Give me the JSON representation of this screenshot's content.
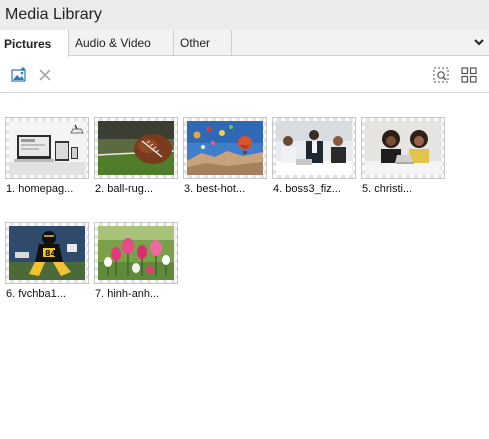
{
  "window": {
    "title": "Media Library"
  },
  "tabs": [
    {
      "label": "Pictures",
      "active": true
    },
    {
      "label": "Audio & Video",
      "active": false
    },
    {
      "label": "Other",
      "active": false
    }
  ],
  "toolbar": {
    "icons": [
      "insert-picture-icon",
      "delete-icon",
      "select-area-icon",
      "grid-view-icon"
    ]
  },
  "colors": {
    "accent": "#2b79c2",
    "tab_bar": "#f2f2f2",
    "title_bar": "#ececec"
  },
  "items": [
    {
      "caption": "1. homepag..."
    },
    {
      "caption": "2. ball-rug..."
    },
    {
      "caption": "3. best-hot..."
    },
    {
      "caption": "4. boss3_fiz..."
    },
    {
      "caption": "5. christi..."
    },
    {
      "caption": "6. fvchba1..."
    },
    {
      "caption": "7. hinh-anh..."
    }
  ]
}
